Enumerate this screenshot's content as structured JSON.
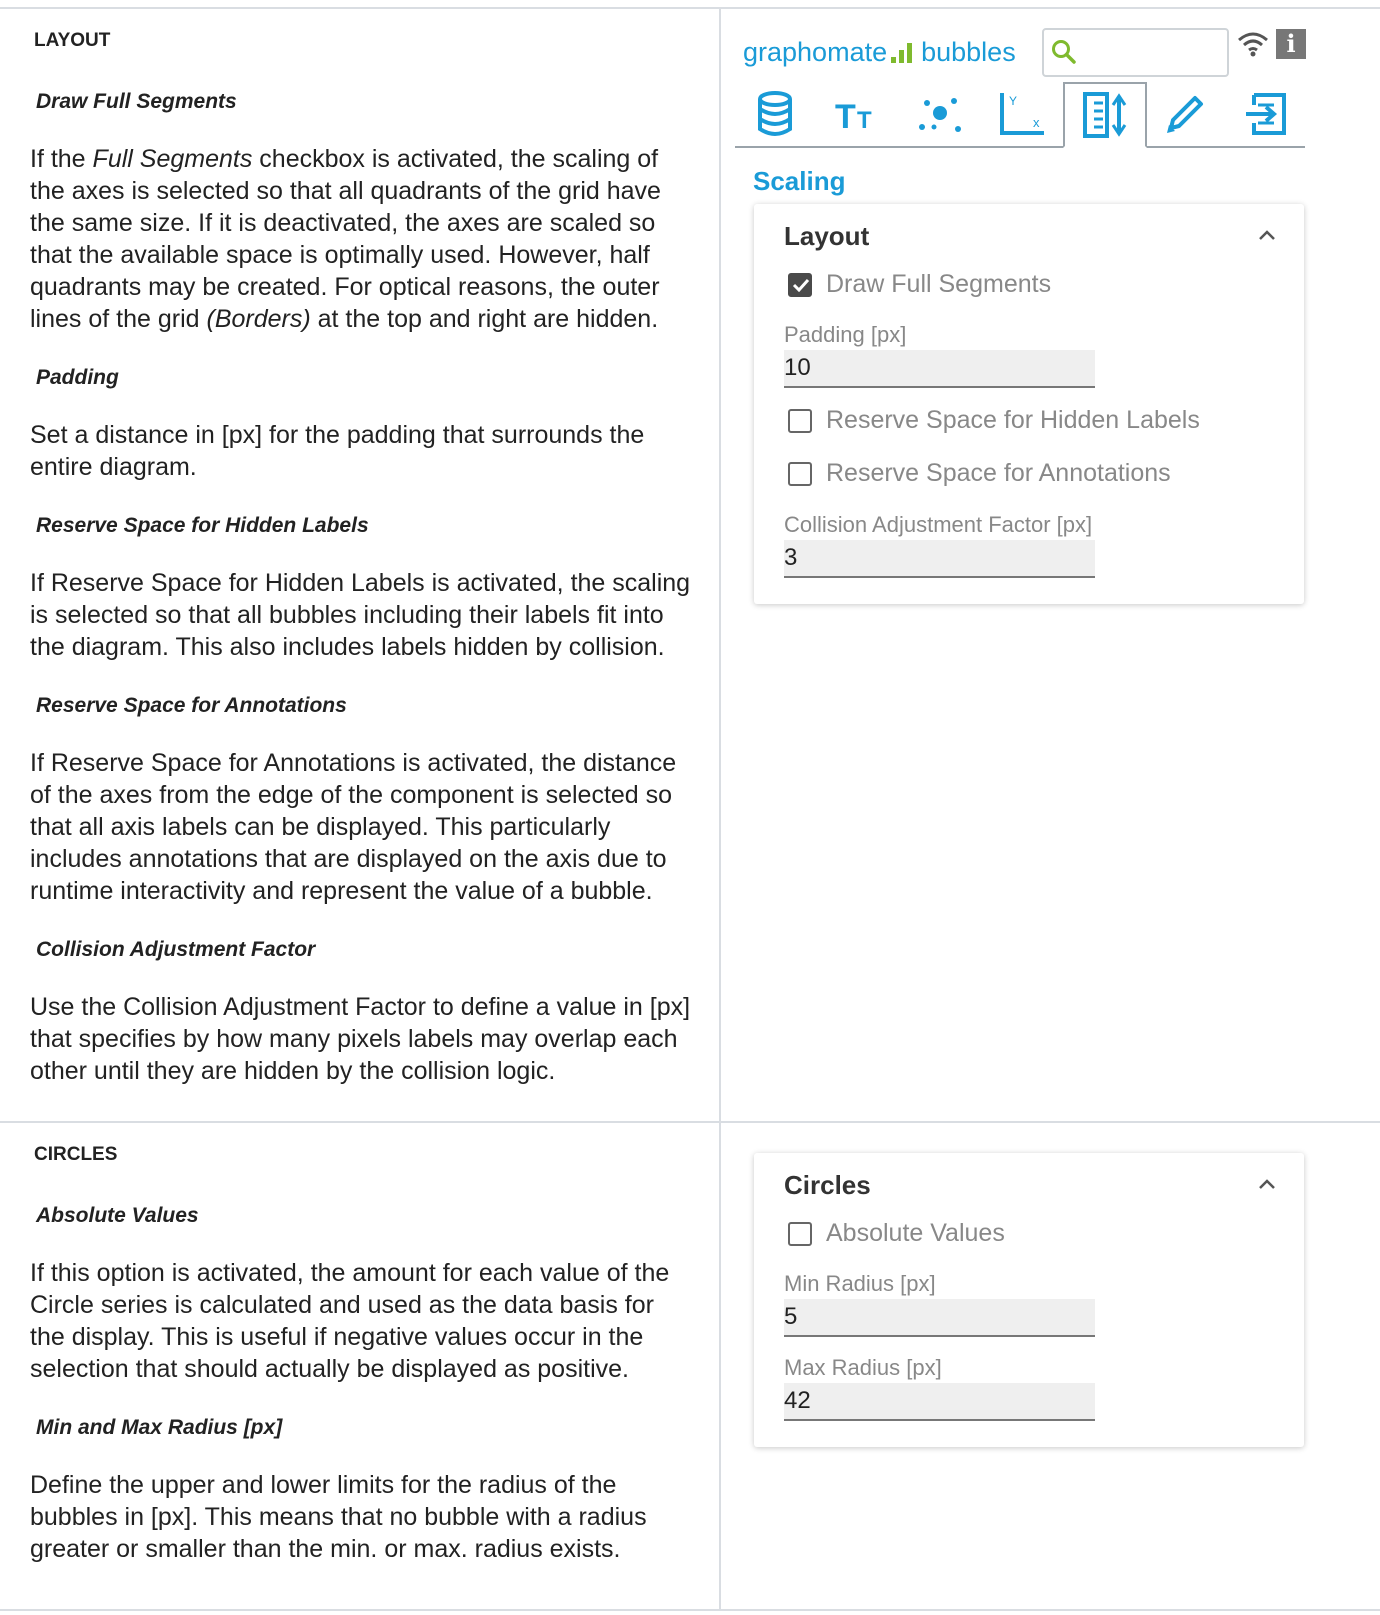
{
  "layout_section": {
    "section_title": "LAYOUT",
    "options": [
      {
        "title": "Draw Full Segments",
        "paragraphs": [
          {
            "parts": [
              {
                "text": "If the ",
                "italic": false
              },
              {
                "text": "Full Segments",
                "italic": true
              },
              {
                "text": " checkbox is activated, the scaling of the axes is selected so that all quadrants of the grid have the same size. If it is deactivated, the axes are scaled so that the available space is optimally used. However, half quadrants may be created. For optical reasons, the outer lines of the grid ",
                "italic": false
              },
              {
                "text": "(Borders)",
                "italic": true
              },
              {
                "text": " at the top and right are hidden.",
                "italic": false
              }
            ]
          }
        ]
      },
      {
        "title": "Padding",
        "paragraphs": [
          {
            "parts": [
              {
                "text": "Set a distance in [px] for the padding that surrounds the entire diagram.",
                "italic": false
              }
            ]
          }
        ]
      },
      {
        "title": "Reserve Space for Hidden Labels",
        "paragraphs": [
          {
            "parts": [
              {
                "text": "If Reserve Space for Hidden Labels is activated, the scaling is selected so that all bubbles including their labels fit into the diagram. This also includes labels hidden by collision.",
                "italic": false
              }
            ]
          }
        ]
      },
      {
        "title": "Reserve Space for Annotations",
        "paragraphs": [
          {
            "parts": [
              {
                "text": "If Reserve Space for Annotations is activated, the distance of the axes from the edge of the component is selected so that all axis labels can be displayed. This particularly includes annotations that are displayed on the axis due to runtime interactivity and represent the value of a bubble.",
                "italic": false
              }
            ]
          }
        ]
      },
      {
        "title": "Collision Adjustment Factor",
        "paragraphs": [
          {
            "parts": [
              {
                "text": "Use the Collision Adjustment Factor to define a value in [px] that specifies by how many pixels labels may overlap each other until they are hidden by the collision logic.",
                "italic": false
              }
            ]
          }
        ]
      }
    ]
  },
  "circles_section": {
    "section_title": "CIRCLES",
    "options": [
      {
        "title": "Absolute Values",
        "paragraphs": [
          {
            "parts": [
              {
                "text": "If this option is activated, the amount for each value of the Circle series is calculated and used as the data basis for the display. This is useful if negative values occur in the selection that should actually be displayed as positive.",
                "italic": false
              }
            ]
          }
        ]
      },
      {
        "title": "Min and Max Radius [px]",
        "paragraphs": [
          {
            "parts": [
              {
                "text": "Define the upper and lower limits for the radius of the bubbles in [px]. This means that no bubble with a radius greater or smaller than the min. or max. radius exists.",
                "italic": false
              }
            ]
          }
        ]
      }
    ]
  },
  "panel": {
    "brand_part1": "graphomate",
    "brand_part2": "bubbles",
    "search_placeholder": "",
    "info_label": "i",
    "tabs": [
      {
        "name": "data-icon"
      },
      {
        "name": "text-format-icon"
      },
      {
        "name": "bubbles-icon"
      },
      {
        "name": "axes-icon"
      },
      {
        "name": "scaling-icon",
        "active": true
      },
      {
        "name": "pencil-icon"
      },
      {
        "name": "export-icon"
      }
    ],
    "scaling_title": "Scaling",
    "layout_card": {
      "title": "Layout",
      "draw_full_segments_label": "Draw Full Segments",
      "draw_full_segments_checked": true,
      "padding_label": "Padding [px]",
      "padding_value": "10",
      "reserve_hidden_label": "Reserve Space for Hidden Labels",
      "reserve_hidden_checked": false,
      "reserve_annotations_label": "Reserve Space for Annotations",
      "reserve_annotations_checked": false,
      "collision_label": "Collision Adjustment Factor [px]",
      "collision_value": "3"
    },
    "circles_card": {
      "title": "Circles",
      "absolute_label": "Absolute Values",
      "absolute_checked": false,
      "min_radius_label": "Min Radius [px]",
      "min_radius_value": "5",
      "max_radius_label": "Max Radius [px]",
      "max_radius_value": "42"
    }
  }
}
